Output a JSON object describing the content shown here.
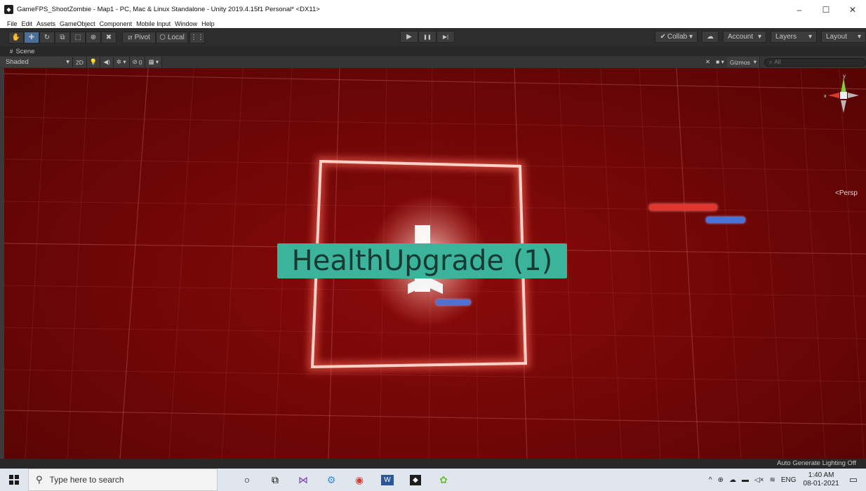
{
  "window": {
    "title": "GameFPS_ShootZombie - Map1 - PC, Mac & Linux Standalone - Unity 2019.4.15f1 Personal* <DX11>",
    "app_icon": "unity-icon",
    "controls": {
      "minimize": "–",
      "maximize": "☐",
      "close": "✕"
    }
  },
  "menu": {
    "items": [
      "File",
      "Edit",
      "Assets",
      "GameObject",
      "Component",
      "Mobile Input",
      "Window",
      "Help"
    ]
  },
  "toolbar": {
    "tools": [
      {
        "name": "hand-tool-icon",
        "glyph": "✋"
      },
      {
        "name": "move-tool-icon",
        "glyph": "✚"
      },
      {
        "name": "rotate-tool-icon",
        "glyph": "↻"
      },
      {
        "name": "scale-tool-icon",
        "glyph": "⧉"
      },
      {
        "name": "rect-tool-icon",
        "glyph": "⬚"
      },
      {
        "name": "transform-tool-icon",
        "glyph": "⊕"
      },
      {
        "name": "custom-tool-icon",
        "glyph": "✖"
      }
    ],
    "pivot_label": "Pivot",
    "local_label": "Local",
    "play_glyph": "▶",
    "pause_glyph": "❚❚",
    "step_glyph": "▶|",
    "collab_label": "Collab ▾",
    "account_label": "Account",
    "layers_label": "Layers",
    "layout_label": "Layout"
  },
  "scene": {
    "tab_label": "Scene",
    "shading_mode": "Shaded",
    "btn_2d": "2D",
    "fx_count": "0",
    "gizmos_label": "Gizmos",
    "search_placeholder": "All",
    "persp_label": "<Persp",
    "object_label": "HealthUpgrade (1)"
  },
  "status": {
    "lighting": "Auto Generate Lighting Off"
  },
  "taskbar": {
    "search_placeholder": "Type here to search",
    "lang": "ENG",
    "time": "1:40 AM",
    "date": "08-01-2021"
  },
  "colors": {
    "viewport_red": "#7a0808",
    "label_teal": "#3cb39b",
    "frame_glow": "#ff9a8a",
    "red_bar": "#e0362f",
    "blue_bar": "#4b72d6"
  }
}
